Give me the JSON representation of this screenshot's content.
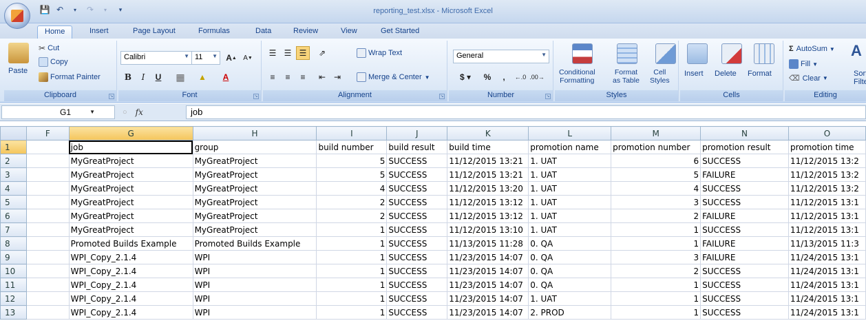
{
  "window": {
    "title": "reporting_test.xlsx - Microsoft Excel"
  },
  "tabs": [
    {
      "label": "Home",
      "active": true
    },
    {
      "label": "Insert"
    },
    {
      "label": "Page Layout"
    },
    {
      "label": "Formulas"
    },
    {
      "label": "Data"
    },
    {
      "label": "Review"
    },
    {
      "label": "View"
    },
    {
      "label": "Get Started"
    }
  ],
  "ribbon": {
    "clipboard": {
      "label": "Clipboard",
      "paste": "Paste",
      "cut": "Cut",
      "copy": "Copy",
      "format_painter": "Format Painter"
    },
    "font": {
      "label": "Font",
      "name": "Calibri",
      "size": "11"
    },
    "alignment": {
      "label": "Alignment",
      "wrap_text": "Wrap Text",
      "merge_center": "Merge & Center"
    },
    "number": {
      "label": "Number",
      "format": "General"
    },
    "styles": {
      "label": "Styles",
      "conditional": "Conditional",
      "conditional2": "Formatting",
      "format": "Format",
      "format2": "as Table",
      "cell": "Cell",
      "cell2": "Styles"
    },
    "cells": {
      "label": "Cells",
      "insert": "Insert",
      "delete": "Delete",
      "format": "Format"
    },
    "editing": {
      "label": "Editing",
      "autosum": "AutoSum",
      "fill": "Fill",
      "clear": "Clear",
      "sort": "Sort",
      "filter": "Filte"
    }
  },
  "formula_bar": {
    "name_box": "G1",
    "fx": "fx",
    "content": "job"
  },
  "grid": {
    "columns": [
      "F",
      "G",
      "H",
      "I",
      "J",
      "K",
      "L",
      "M",
      "N",
      "O"
    ],
    "selected_column": "G",
    "selected_row": "1",
    "rows": [
      {
        "n": "1",
        "cells": [
          "",
          "job",
          "group",
          "build number",
          "build result",
          "build time",
          "promotion name",
          "promotion number",
          "promotion result",
          "promotion time"
        ]
      },
      {
        "n": "2",
        "cells": [
          "",
          "MyGreatProject",
          "MyGreatProject",
          "5",
          "SUCCESS",
          "11/12/2015 13:21",
          "1. UAT",
          "6",
          "SUCCESS",
          "11/12/2015 13:2"
        ]
      },
      {
        "n": "3",
        "cells": [
          "",
          "MyGreatProject",
          "MyGreatProject",
          "5",
          "SUCCESS",
          "11/12/2015 13:21",
          "1. UAT",
          "5",
          "FAILURE",
          "11/12/2015 13:2"
        ]
      },
      {
        "n": "4",
        "cells": [
          "",
          "MyGreatProject",
          "MyGreatProject",
          "4",
          "SUCCESS",
          "11/12/2015 13:20",
          "1. UAT",
          "4",
          "SUCCESS",
          "11/12/2015 13:2"
        ]
      },
      {
        "n": "5",
        "cells": [
          "",
          "MyGreatProject",
          "MyGreatProject",
          "2",
          "SUCCESS",
          "11/12/2015 13:12",
          "1. UAT",
          "3",
          "SUCCESS",
          "11/12/2015 13:1"
        ]
      },
      {
        "n": "6",
        "cells": [
          "",
          "MyGreatProject",
          "MyGreatProject",
          "2",
          "SUCCESS",
          "11/12/2015 13:12",
          "1. UAT",
          "2",
          "FAILURE",
          "11/12/2015 13:1"
        ]
      },
      {
        "n": "7",
        "cells": [
          "",
          "MyGreatProject",
          "MyGreatProject",
          "1",
          "SUCCESS",
          "11/12/2015 13:10",
          "1. UAT",
          "1",
          "SUCCESS",
          "11/12/2015 13:1"
        ]
      },
      {
        "n": "8",
        "cells": [
          "",
          "Promoted Builds Example",
          "Promoted Builds Example",
          "1",
          "SUCCESS",
          "11/13/2015 11:28",
          "0. QA",
          "1",
          "FAILURE",
          "11/13/2015 11:3"
        ]
      },
      {
        "n": "9",
        "cells": [
          "",
          "WPI_Copy_2.1.4",
          "WPI",
          "1",
          "SUCCESS",
          "11/23/2015 14:07",
          "0. QA",
          "3",
          "FAILURE",
          "11/24/2015 13:1"
        ]
      },
      {
        "n": "10",
        "cells": [
          "",
          "WPI_Copy_2.1.4",
          "WPI",
          "1",
          "SUCCESS",
          "11/23/2015 14:07",
          "0. QA",
          "2",
          "SUCCESS",
          "11/24/2015 13:1"
        ]
      },
      {
        "n": "11",
        "cells": [
          "",
          "WPI_Copy_2.1.4",
          "WPI",
          "1",
          "SUCCESS",
          "11/23/2015 14:07",
          "0. QA",
          "1",
          "SUCCESS",
          "11/24/2015 13:1"
        ]
      },
      {
        "n": "12",
        "cells": [
          "",
          "WPI_Copy_2.1.4",
          "WPI",
          "1",
          "SUCCESS",
          "11/23/2015 14:07",
          "1. UAT",
          "1",
          "SUCCESS",
          "11/24/2015 13:1"
        ]
      },
      {
        "n": "13",
        "cells": [
          "",
          "WPI_Copy_2.1.4",
          "WPI",
          "1",
          "SUCCESS",
          "11/23/2015 14:07",
          "2. PROD",
          "1",
          "SUCCESS",
          "11/24/2015 13:1"
        ]
      }
    ]
  }
}
